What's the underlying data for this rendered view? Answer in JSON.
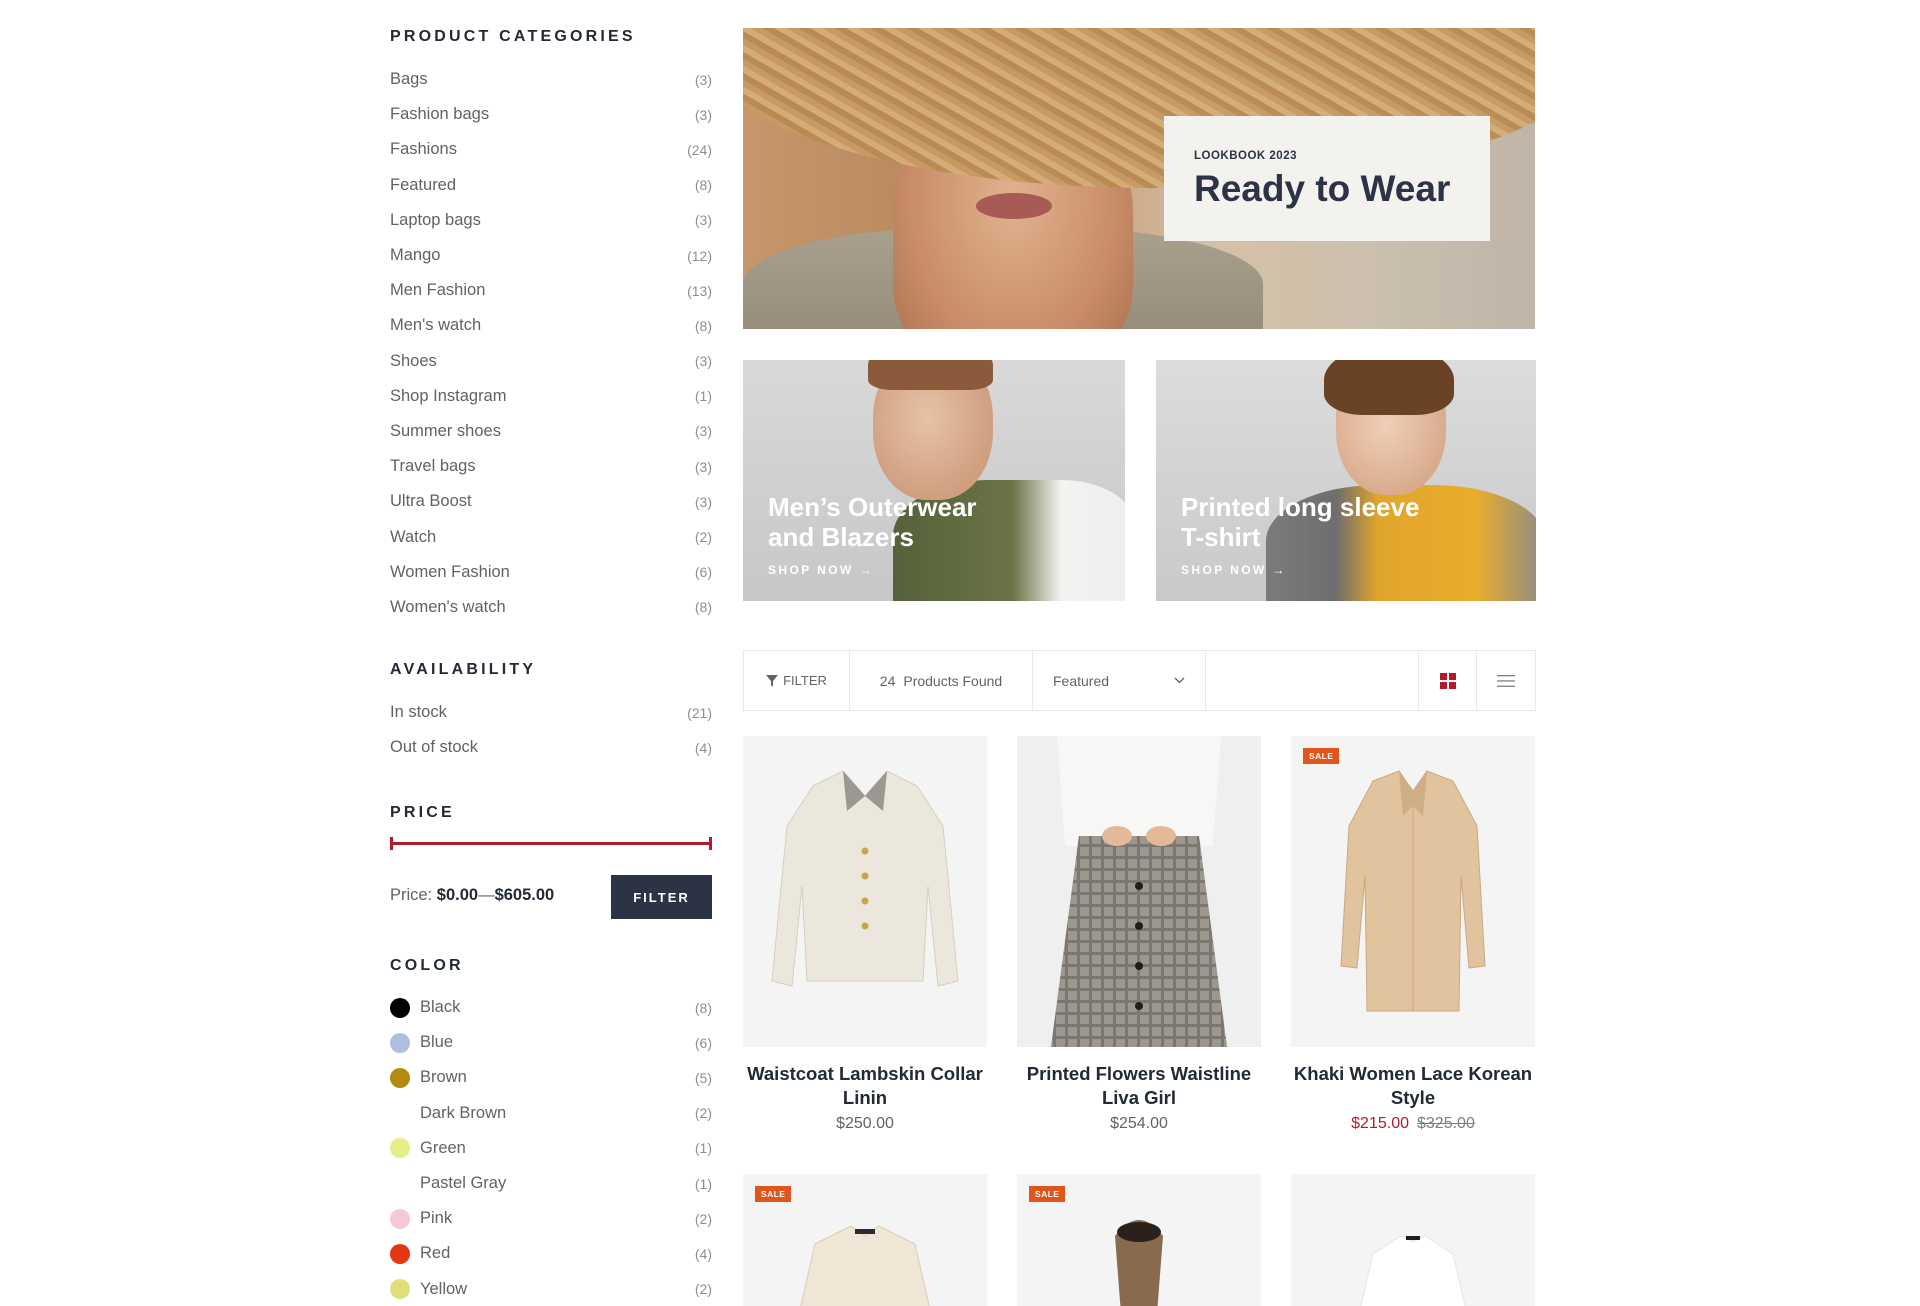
{
  "sidebar": {
    "categories": {
      "title": "PRODUCT CATEGORIES",
      "items": [
        {
          "label": "Bags",
          "count": "(3)"
        },
        {
          "label": "Fashion bags",
          "count": "(3)"
        },
        {
          "label": "Fashions",
          "count": "(24)"
        },
        {
          "label": "Featured",
          "count": "(8)"
        },
        {
          "label": "Laptop bags",
          "count": "(3)"
        },
        {
          "label": "Mango",
          "count": "(12)"
        },
        {
          "label": "Men Fashion",
          "count": "(13)"
        },
        {
          "label": "Men's watch",
          "count": "(8)"
        },
        {
          "label": "Shoes",
          "count": "(3)"
        },
        {
          "label": "Shop Instagram",
          "count": "(1)"
        },
        {
          "label": "Summer shoes",
          "count": "(3)"
        },
        {
          "label": "Travel bags",
          "count": "(3)"
        },
        {
          "label": "Ultra Boost",
          "count": "(3)"
        },
        {
          "label": "Watch",
          "count": "(2)"
        },
        {
          "label": "Women Fashion",
          "count": "(6)"
        },
        {
          "label": "Women's watch",
          "count": "(8)"
        }
      ]
    },
    "availability": {
      "title": "AVAILABILITY",
      "items": [
        {
          "label": "In stock",
          "count": "(21)"
        },
        {
          "label": "Out of stock",
          "count": "(4)"
        }
      ]
    },
    "price": {
      "title": "PRICE",
      "label": "Price:",
      "min": "$0.00",
      "separator": "—",
      "max": "$605.00",
      "button": "FILTER",
      "range_start_fraction": 0.0,
      "range_end_fraction": 1.0,
      "accent": "#b31b2c"
    },
    "colors": {
      "title": "COLOR",
      "items": [
        {
          "label": "Black",
          "count": "(8)",
          "swatch": "#000000"
        },
        {
          "label": "Blue",
          "count": "(6)",
          "swatch": "#aebfde"
        },
        {
          "label": "Brown",
          "count": "(5)",
          "swatch": "#b38b12"
        },
        {
          "label": "Dark Brown",
          "count": "(2)",
          "swatch": ""
        },
        {
          "label": "Green",
          "count": "(1)",
          "swatch": "#e5ee86"
        },
        {
          "label": "Pastel Gray",
          "count": "(1)",
          "swatch": ""
        },
        {
          "label": "Pink",
          "count": "(2)",
          "swatch": "#f6c8dc"
        },
        {
          "label": "Red",
          "count": "(4)",
          "swatch": "#e63810"
        },
        {
          "label": "Yellow",
          "count": "(2)",
          "swatch": "#dfe07a"
        }
      ]
    }
  },
  "hero": {
    "eyebrow": "LOOKBOOK 2023",
    "title": "Ready to Wear"
  },
  "promos": [
    {
      "title": "Men’s Outerwear and Blazers",
      "link": "SHOP NOW →"
    },
    {
      "title": "Printed long sleeve T-shirt",
      "link": "SHOP NOW →"
    }
  ],
  "toolbar": {
    "filter_icon": "funnel-icon",
    "filter_label": "FILTER",
    "found_count": "24",
    "found_label": "Products Found",
    "sort_value": "Featured",
    "grid_icon": "grid-view-icon",
    "list_icon": "list-view-icon",
    "grid_active_color": "#b31b2c"
  },
  "products": [
    {
      "name": "Waistcoat Lambskin Collar Linin",
      "price": "$250.00",
      "sale_price": "",
      "old_price": "",
      "badge": ""
    },
    {
      "name": "Printed Flowers Waistline Liva Girl",
      "price": "$254.00",
      "sale_price": "",
      "old_price": "",
      "badge": ""
    },
    {
      "name": "Khaki Women Lace Korean Style",
      "price": "",
      "sale_price": "$215.00",
      "old_price": "$325.00",
      "badge": "SALE"
    },
    {
      "name": "",
      "price": "",
      "sale_price": "",
      "old_price": "",
      "badge": "SALE"
    },
    {
      "name": "",
      "price": "",
      "sale_price": "",
      "old_price": "",
      "badge": "SALE"
    },
    {
      "name": "",
      "price": "",
      "sale_price": "",
      "old_price": "",
      "badge": ""
    }
  ]
}
